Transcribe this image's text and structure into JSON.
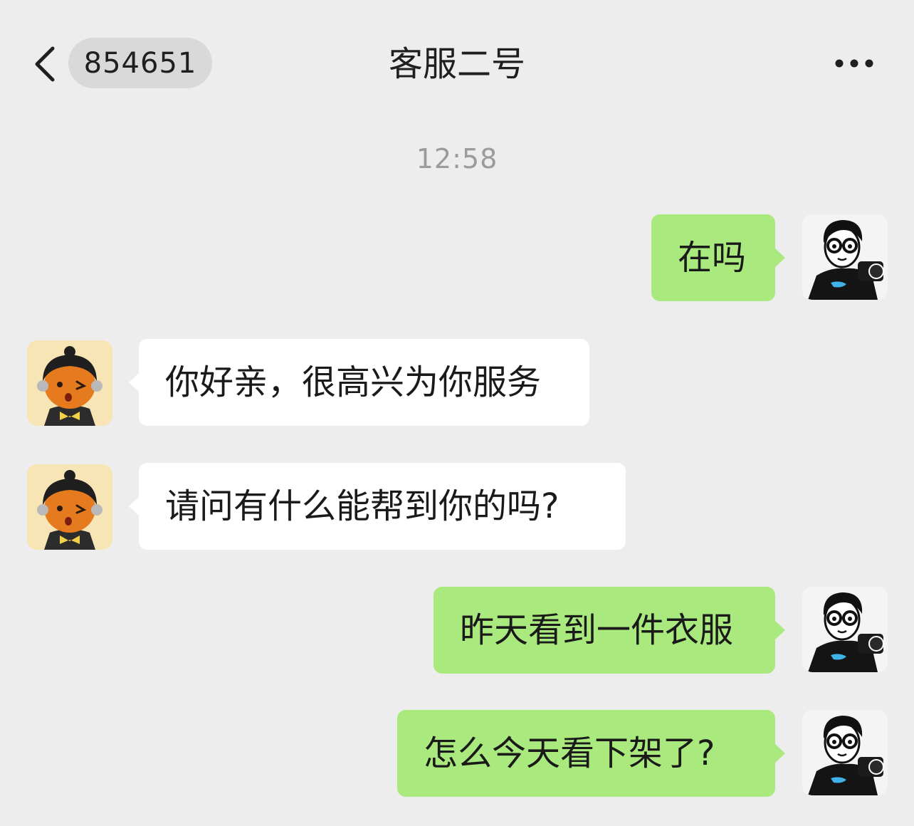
{
  "header": {
    "back_icon": "chevron-left-icon",
    "unread_count": "854651",
    "title": "客服二号",
    "more_icon": "ellipsis-icon"
  },
  "timestamp": "12:58",
  "messages": [
    {
      "from": "me",
      "text": "在吗"
    },
    {
      "from": "agent",
      "text": "你好亲，很高兴为你服务"
    },
    {
      "from": "agent",
      "text": "请问有什么能帮到你的吗?"
    },
    {
      "from": "me",
      "text": "昨天看到一件衣服"
    },
    {
      "from": "me",
      "text": "怎么今天看下架了?"
    }
  ],
  "colors": {
    "background": "#ededed",
    "sent_bubble": "#a9e97d",
    "received_bubble": "#ffffff",
    "timestamp": "#9b9b9b",
    "agent_avatar_bg": "#f7e5b5"
  }
}
